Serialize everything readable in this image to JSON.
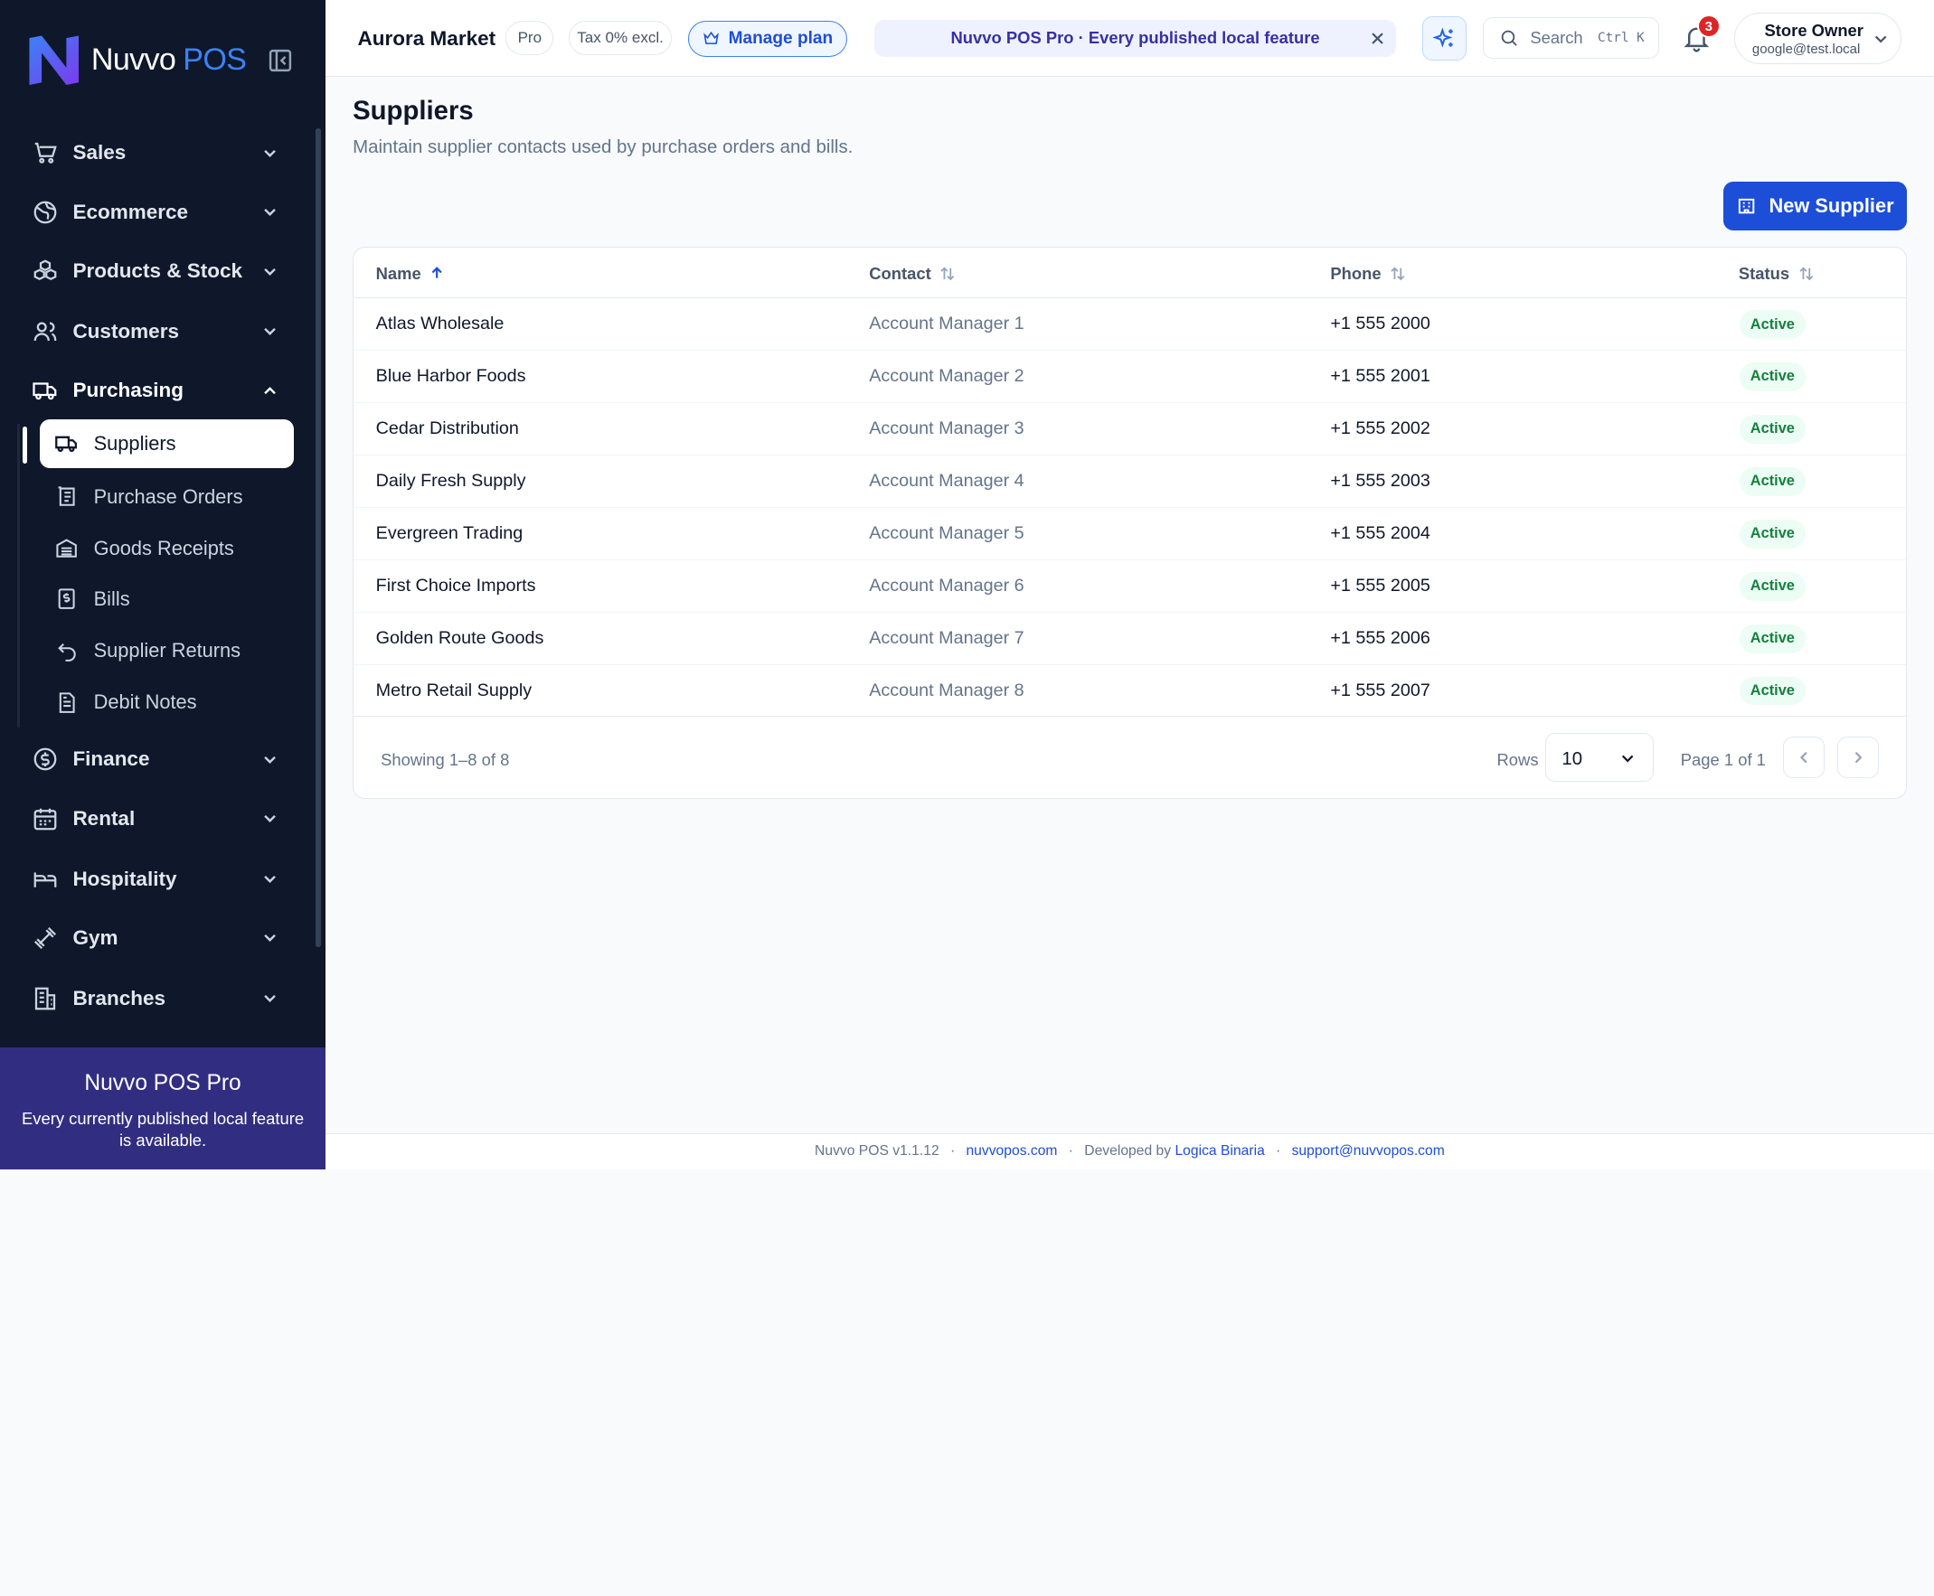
{
  "brand": {
    "name": "Nuvvo",
    "suffix": "POS"
  },
  "sidebar": {
    "sections": [
      {
        "label": "Sales",
        "icon": "cart-icon"
      },
      {
        "label": "Ecommerce",
        "icon": "globe-icon"
      },
      {
        "label": "Products & Stock",
        "icon": "boxes-icon"
      },
      {
        "label": "Customers",
        "icon": "users-icon"
      },
      {
        "label": "Purchasing",
        "icon": "truck-icon",
        "expanded": true
      },
      {
        "label": "Finance",
        "icon": "dollar-icon"
      },
      {
        "label": "Rental",
        "icon": "calendar-icon"
      },
      {
        "label": "Hospitality",
        "icon": "bed-icon"
      },
      {
        "label": "Gym",
        "icon": "dumbbell-icon"
      },
      {
        "label": "Branches",
        "icon": "building-icon"
      }
    ],
    "purchasing_items": [
      {
        "label": "Suppliers",
        "icon": "truck-icon",
        "active": true
      },
      {
        "label": "Purchase Orders",
        "icon": "order-icon"
      },
      {
        "label": "Goods Receipts",
        "icon": "warehouse-icon"
      },
      {
        "label": "Bills",
        "icon": "bill-icon"
      },
      {
        "label": "Supplier Returns",
        "icon": "undo-icon"
      },
      {
        "label": "Debit Notes",
        "icon": "note-icon"
      }
    ],
    "promo": {
      "title": "Nuvvo POS Pro",
      "text": "Every currently published local feature is available."
    }
  },
  "header": {
    "store_name": "Aurora Market",
    "plan_pill": "Pro",
    "tax_pill": "Tax 0% excl.",
    "manage_plan": "Manage plan",
    "banner": "Nuvvo POS Pro · Every published local feature",
    "search_placeholder": "Search",
    "search_shortcut": "Ctrl K",
    "notifications_count": "3",
    "user_name": "Store Owner",
    "user_email": "google@test.local"
  },
  "page": {
    "title": "Suppliers",
    "subtitle": "Maintain supplier contacts used by purchase orders and bills.",
    "new_button": "New Supplier"
  },
  "table": {
    "columns": [
      "Name",
      "Contact",
      "Phone",
      "Status"
    ],
    "sorted_by": "Name",
    "sort_direction": "asc",
    "rows": [
      {
        "name": "Atlas Wholesale",
        "contact": "Account Manager 1",
        "phone": "+1 555 2000",
        "status": "Active"
      },
      {
        "name": "Blue Harbor Foods",
        "contact": "Account Manager 2",
        "phone": "+1 555 2001",
        "status": "Active"
      },
      {
        "name": "Cedar Distribution",
        "contact": "Account Manager 3",
        "phone": "+1 555 2002",
        "status": "Active"
      },
      {
        "name": "Daily Fresh Supply",
        "contact": "Account Manager 4",
        "phone": "+1 555 2003",
        "status": "Active"
      },
      {
        "name": "Evergreen Trading",
        "contact": "Account Manager 5",
        "phone": "+1 555 2004",
        "status": "Active"
      },
      {
        "name": "First Choice Imports",
        "contact": "Account Manager 6",
        "phone": "+1 555 2005",
        "status": "Active"
      },
      {
        "name": "Golden Route Goods",
        "contact": "Account Manager 7",
        "phone": "+1 555 2006",
        "status": "Active"
      },
      {
        "name": "Metro Retail Supply",
        "contact": "Account Manager 8",
        "phone": "+1 555 2007",
        "status": "Active"
      }
    ],
    "showing": "Showing 1–8 of 8",
    "rows_label": "Rows",
    "rows_value": "10",
    "page_info": "Page 1 of 1"
  },
  "footer": {
    "version": "Nuvvo POS v1.1.12",
    "site": "nuvvopos.com",
    "developed_by": "Developed by",
    "developer": "Logica Binaria",
    "support": "support@nuvvopos.com"
  },
  "colors": {
    "sidebar_bg": "#0f172a",
    "accent": "#1d4ed8",
    "promo_bg": "#312e81",
    "status_active_text": "#15803d",
    "status_active_bg": "#ecfdf5",
    "badge_red": "#dc2626"
  }
}
